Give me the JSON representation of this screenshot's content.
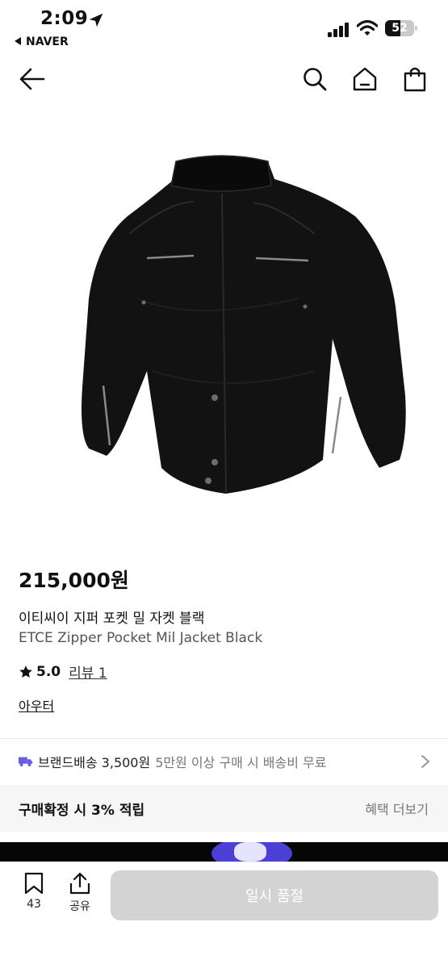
{
  "status_bar": {
    "time": "2:09",
    "back_app": "NAVER",
    "battery": "52",
    "battery_level": 0.52
  },
  "product": {
    "price": "215,000원",
    "title_ko": "이티씨이 지퍼 포켓 밀 자켓 블랙",
    "title_en": "ETCE Zipper Pocket Mil Jacket Black",
    "rating": "5.0",
    "reviews": "리뷰 1",
    "category": "아우터"
  },
  "shipping": {
    "brand": "브랜드배송 3,500원",
    "note": "5만원 이상 구매 시 배송비 무료"
  },
  "benefit": {
    "label": "구매확정 시 3% 적립",
    "more": "혜택 더보기"
  },
  "bottom_bar": {
    "bookmark_count": "43",
    "share_label": "공유",
    "buy_button": "일시 품절"
  },
  "icons": {
    "back": "arrow-left-icon",
    "search": "search-icon",
    "home": "home-icon",
    "bag": "shopping-bag-icon",
    "star": "star-icon",
    "truck": "truck-icon",
    "bookmark": "bookmark-icon",
    "share": "share-icon"
  },
  "colors": {
    "accent_purple": "#6b5ce7",
    "disabled_button": "#d3d3d3"
  }
}
